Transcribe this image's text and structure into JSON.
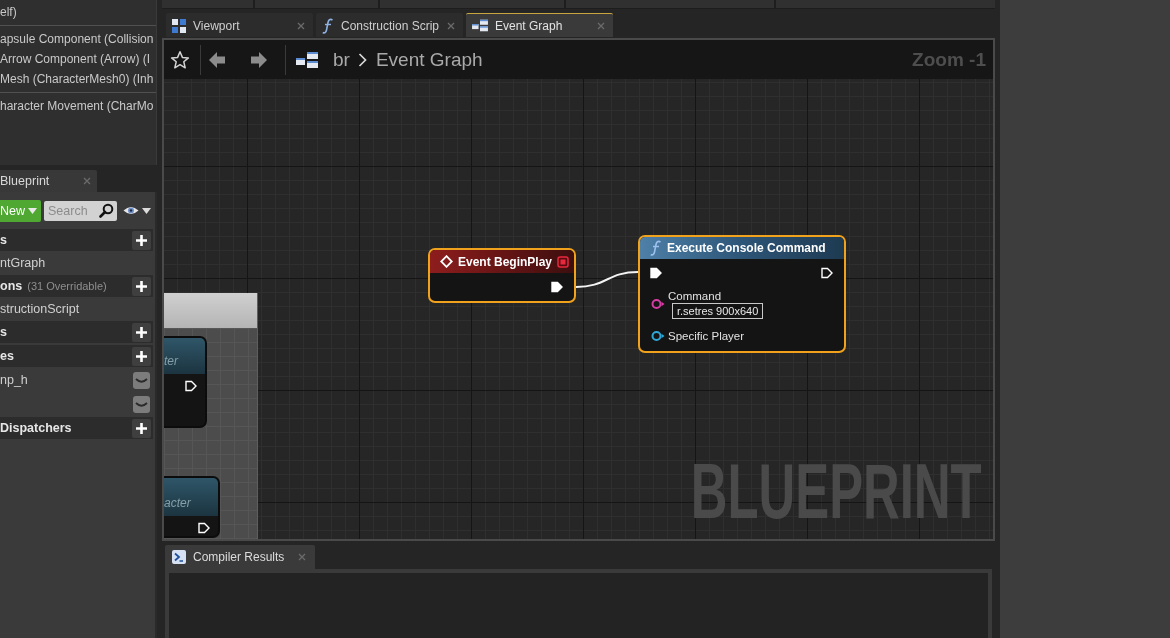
{
  "components_panel": {
    "groups": [
      {
        "items": [
          "elf)"
        ]
      },
      {
        "items": [
          "apsule Component (Collision",
          "Arrow Component (Arrow) (I",
          "Mesh (CharacterMesh0) (Inh"
        ]
      },
      {
        "items": [
          "haracter Movement (CharMo"
        ]
      }
    ]
  },
  "my_blueprint": {
    "tab": {
      "label": "Blueprint"
    },
    "new_button": {
      "label": "New"
    },
    "search": {
      "placeholder": "Search"
    },
    "rows": [
      {
        "kind": "header",
        "label": "s"
      },
      {
        "kind": "item",
        "label": "ntGraph"
      },
      {
        "kind": "header",
        "label": "ons",
        "note": "(31 Overridable)"
      },
      {
        "kind": "item",
        "label": "structionScript"
      },
      {
        "kind": "header",
        "label": "s"
      },
      {
        "kind": "header",
        "label": "es"
      },
      {
        "kind": "variable",
        "label": "np_h",
        "exposed": false
      },
      {
        "kind": "variable",
        "exposed": false
      },
      {
        "kind": "header",
        "label": "Dispatchers"
      }
    ]
  },
  "graph_editor": {
    "tabs": [
      {
        "kind": "viewport",
        "label": "Viewport",
        "selected": false
      },
      {
        "kind": "function",
        "label": "Construction Scrip",
        "selected": false
      },
      {
        "kind": "graph",
        "label": "Event Graph",
        "selected": true
      }
    ],
    "breadcrumb": [
      "br",
      "Event Graph"
    ],
    "zoom": "Zoom -1",
    "watermark": "BLUEPRINT",
    "nodes": [
      {
        "kind": "event",
        "title": "Event BeginPlay",
        "selected": true,
        "pins": [
          {
            "kind": "exec_out",
            "connected": true
          }
        ]
      },
      {
        "kind": "function",
        "title": "Execute Console Command",
        "selected": true,
        "pins": [
          {
            "kind": "exec_in",
            "connected": true
          },
          {
            "kind": "exec_out",
            "connected": false
          },
          {
            "kind": "data",
            "label": "Command",
            "value": "r.setres 900x640",
            "color": "#d63ca3",
            "connected": false
          },
          {
            "kind": "data",
            "label": "Specific Player",
            "color": "#2ea6d6",
            "connected": false
          }
        ]
      },
      {
        "kind": "clipped",
        "title": "ter",
        "selected": false,
        "pins": [
          {
            "kind": "exec_out",
            "connected": false
          }
        ]
      },
      {
        "kind": "clipped",
        "title": "acter",
        "selected": false,
        "pins": [
          {
            "kind": "exec_out",
            "connected": false
          }
        ]
      }
    ]
  },
  "compiler_results": {
    "tab": {
      "label": "Compiler Results"
    }
  }
}
